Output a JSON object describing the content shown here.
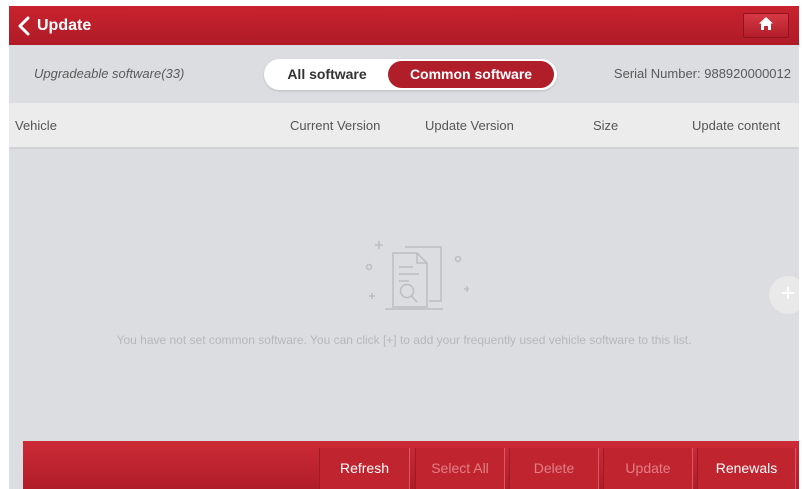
{
  "header": {
    "title": "Update",
    "back_icon": "chevron-left-icon",
    "home_icon": "home-icon"
  },
  "subheader": {
    "upgradeable": "Upgradeable software(33)",
    "tabs": [
      {
        "label": "All software",
        "active": false
      },
      {
        "label": "Common software",
        "active": true
      }
    ],
    "serial": "Serial Number: 988920000012"
  },
  "table": {
    "columns": [
      "Vehicle",
      "Current Version",
      "Update Version",
      "Size",
      "Update content"
    ]
  },
  "empty": {
    "icon": "document-search-icon",
    "message": "You have not set common software. You can click [+] to add your frequently used vehicle software to this list."
  },
  "fab_icon": "plus-icon",
  "toolbar": {
    "refresh": "Refresh",
    "select_all": "Select All",
    "delete": "Delete",
    "update": "Update",
    "renewals": "Renewals"
  },
  "colors": {
    "brand_red": "#b01e2a",
    "background": "#dcdde0",
    "disabled_text": "#e27f86"
  }
}
